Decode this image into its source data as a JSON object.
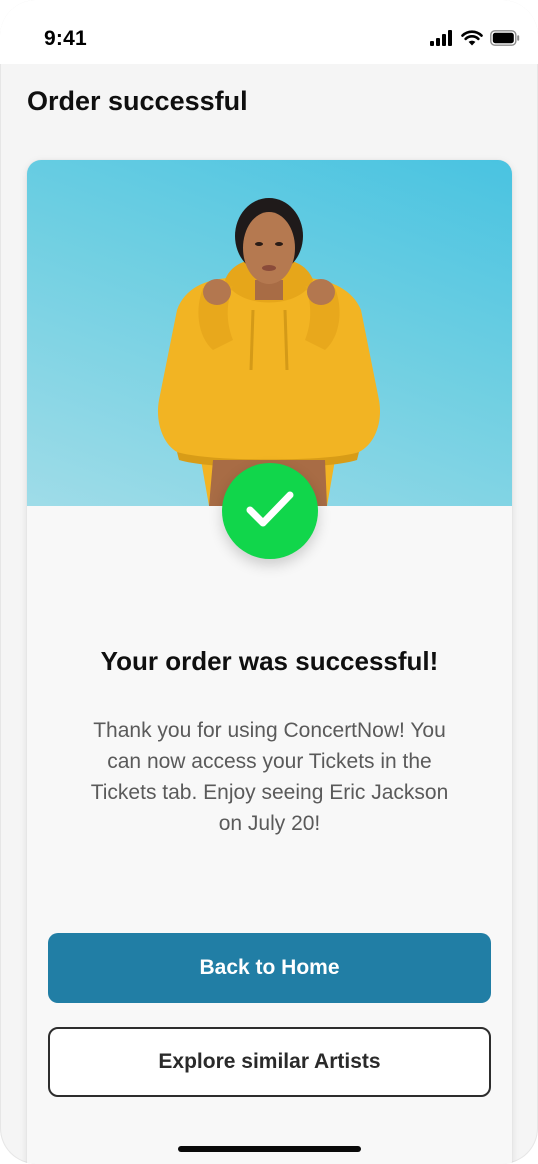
{
  "status_bar": {
    "time": "9:41",
    "icons": [
      "cellular-signal-icon",
      "wifi-icon",
      "battery-icon"
    ]
  },
  "header": {
    "title": "Order successful"
  },
  "card": {
    "image": "artist-photo",
    "status_icon": "checkmark-icon",
    "heading": "Your order was successful!",
    "message": "Thank you for using ConcertNow! You can now access your Tickets in the Tickets tab. Enjoy seeing Eric Jackson on July 20!"
  },
  "actions": {
    "primary_label": "Back to Home",
    "secondary_label": "Explore similar Artists"
  },
  "colors": {
    "primary_button": "#217ea5",
    "success_badge": "#11d64b",
    "background": "#f5f5f5",
    "card_background": "#f8f8f8",
    "hero_sky": "#49c3e1"
  }
}
